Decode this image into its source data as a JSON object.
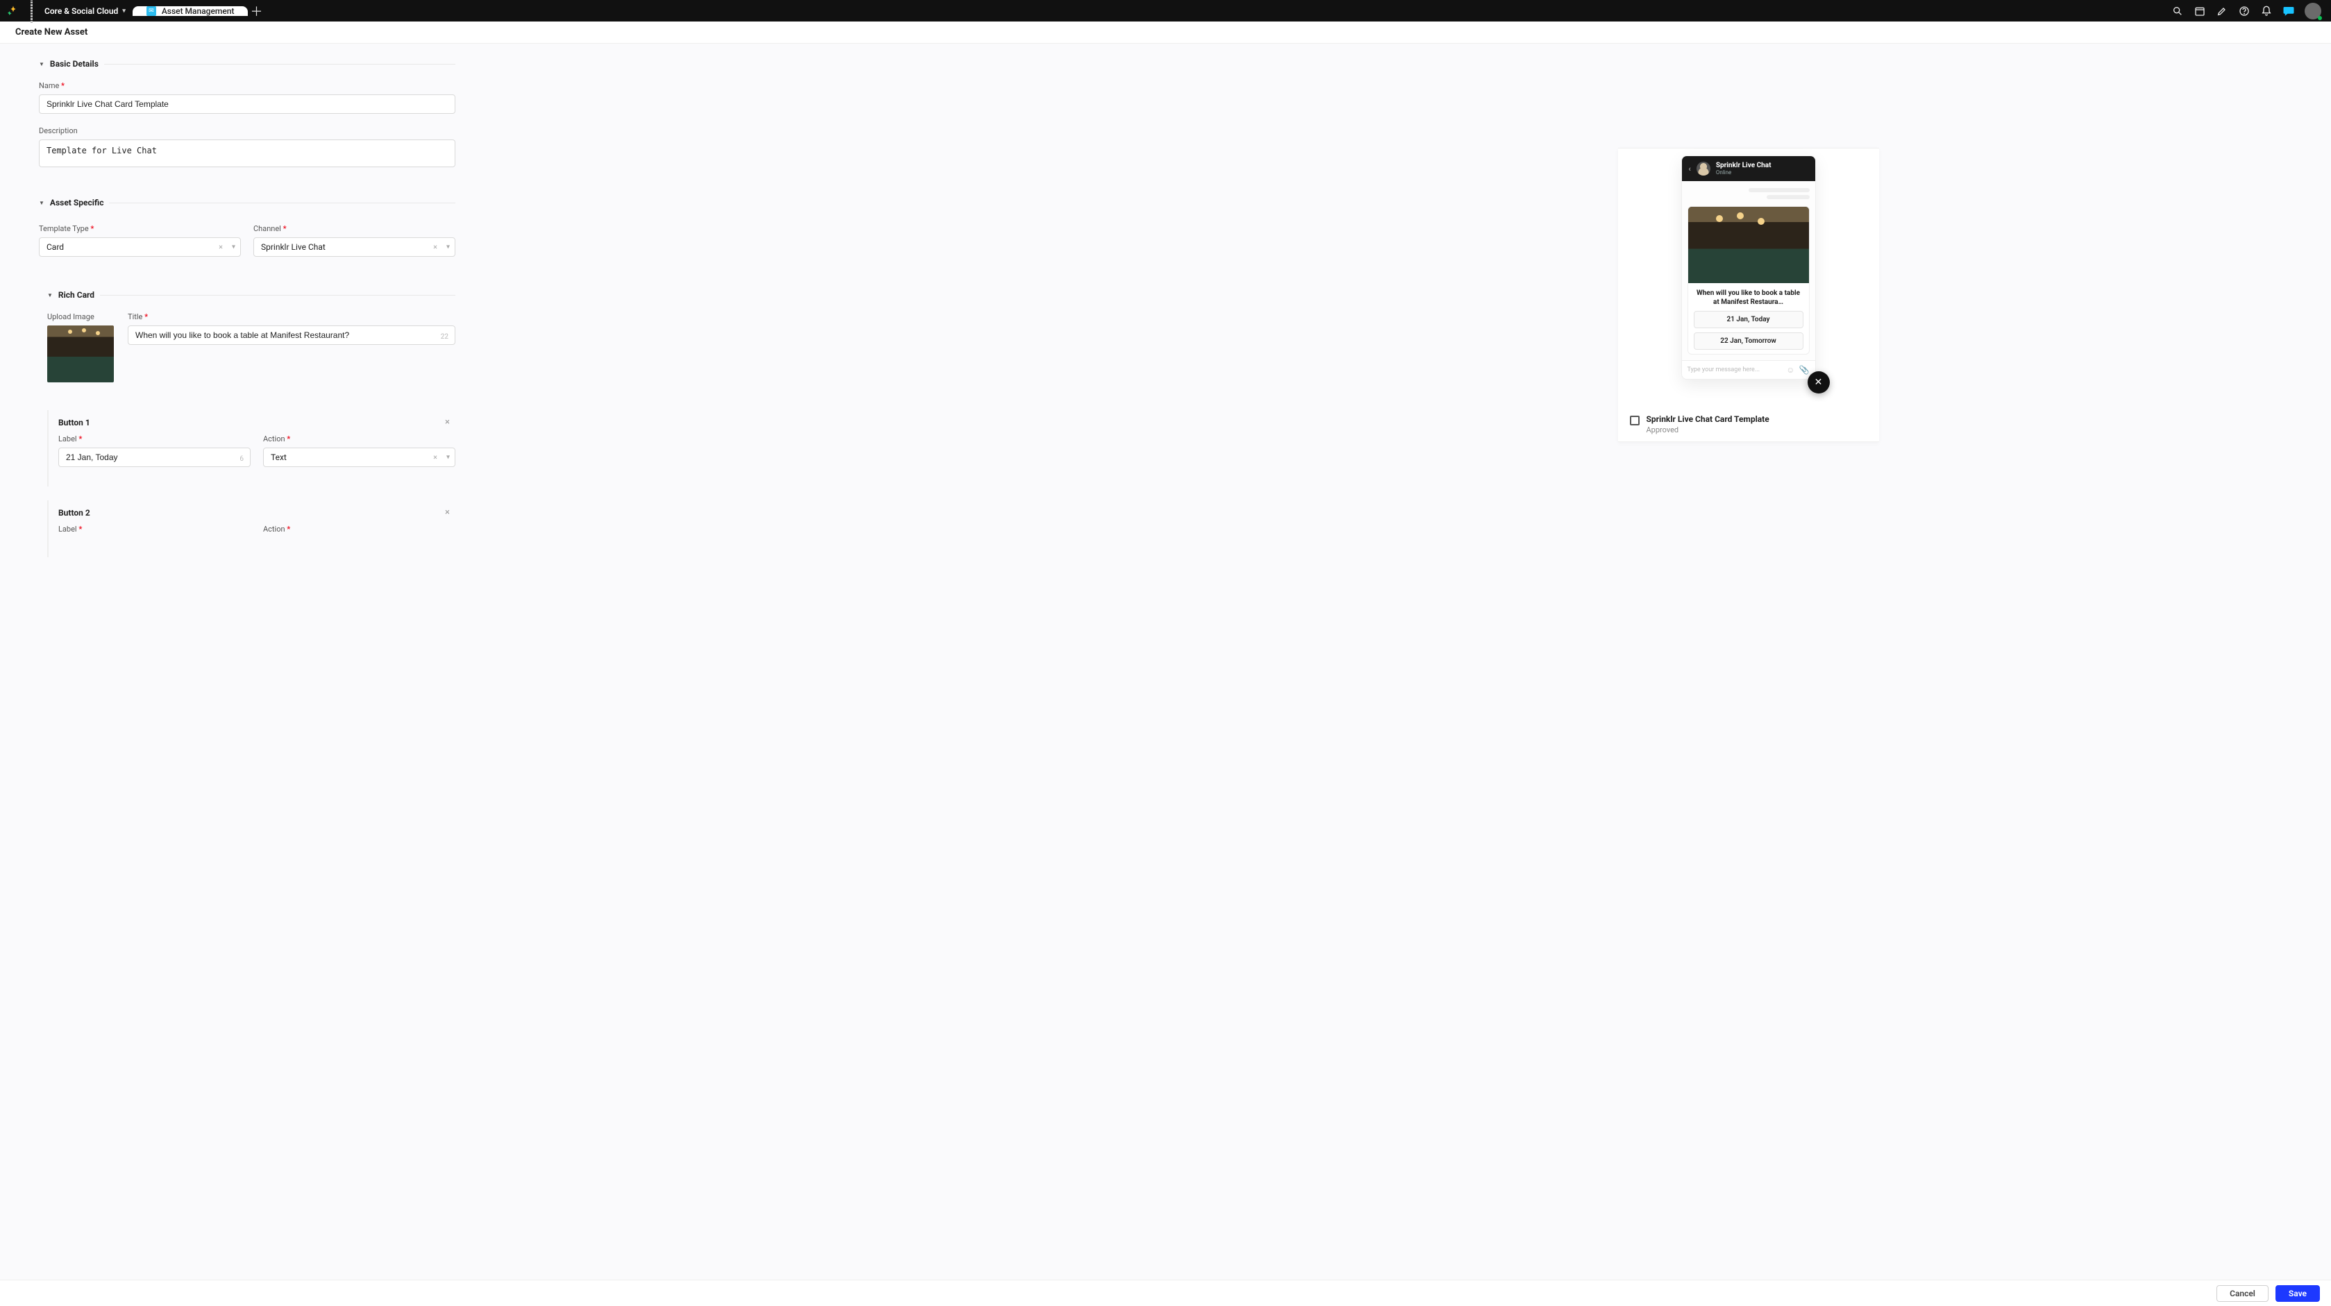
{
  "topbar": {
    "cloud_name": "Core & Social Cloud",
    "tab_label": "Asset Management"
  },
  "subheader": {
    "title": "Create New Asset"
  },
  "sections": {
    "basic": {
      "title": "Basic Details",
      "name_label": "Name",
      "name_value": "Sprinklr Live Chat Card Template",
      "desc_label": "Description",
      "desc_value": "Template for Live Chat"
    },
    "asset_specific": {
      "title": "Asset Specific",
      "template_type_label": "Template Type",
      "template_type_value": "Card",
      "channel_label": "Channel",
      "channel_value": "Sprinklr Live Chat"
    },
    "rich_card": {
      "title": "Rich Card",
      "upload_label": "Upload Image",
      "title_label": "Title",
      "title_value": "When will you like to book a table at Manifest Restaurant?",
      "title_counter": "22",
      "buttons": [
        {
          "heading": "Button 1",
          "label_label": "Label",
          "label_value": "21 Jan, Today",
          "label_counter": "6",
          "action_label": "Action",
          "action_value": "Text"
        },
        {
          "heading": "Button 2",
          "label_label": "Label",
          "label_value": "",
          "action_label": "Action",
          "action_value": ""
        }
      ]
    }
  },
  "preview": {
    "chat_title": "Sprinklr Live Chat",
    "chat_status": "Online",
    "card_title": "When will you like to book a table at Manifest Restaura…",
    "btn1": "21 Jan, Today",
    "btn2": "22 Jan, Tomorrow",
    "input_placeholder": "Type your message here...",
    "file_name": "Sprinklr Live Chat Card Template",
    "file_status": "Approved"
  },
  "footer": {
    "cancel": "Cancel",
    "save": "Save"
  }
}
